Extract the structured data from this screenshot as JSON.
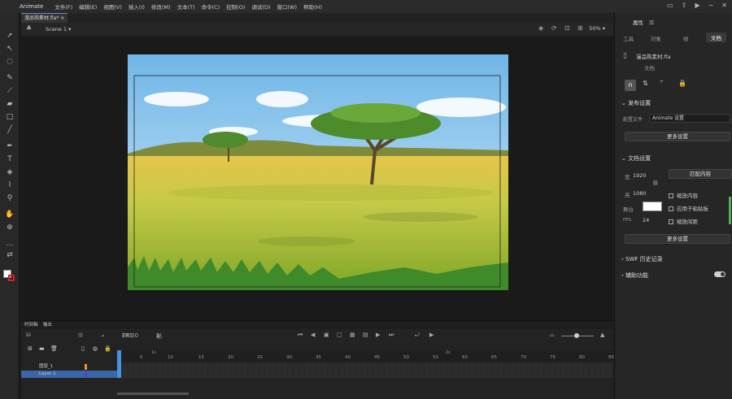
{
  "menubar": {
    "app": "Animate",
    "items": [
      "文件(F)",
      "编辑(E)",
      "视图(V)",
      "插入(I)",
      "修改(M)",
      "文本(T)",
      "命令(C)",
      "控制(O)",
      "调试(D)",
      "窗口(W)",
      "帮助(H)"
    ]
  },
  "document": {
    "tab": "漫品购素材.fla*"
  },
  "stagebar": {
    "scene": "Scene 1",
    "zoom": "50%"
  },
  "timeline": {
    "tabs": [
      "时间轴",
      "输出"
    ],
    "fps": "24.00",
    "fps_unit": "FPS",
    "frame": "1",
    "frame_unit": "帧",
    "ruler": [
      "1s",
      "5",
      "10",
      "15",
      "20",
      "25",
      "30",
      "35",
      "40",
      "45",
      "50",
      "55",
      "60",
      "65",
      "70",
      "75",
      "80",
      "85",
      "2s"
    ],
    "layers": [
      {
        "name": "图层_1",
        "selected": false
      },
      {
        "name": "Layer 1",
        "selected": true
      }
    ]
  },
  "props": {
    "tabs": [
      "工具",
      "对象",
      "帧",
      "文档"
    ],
    "active_tab": "文档",
    "header_tabs": [
      "属性",
      "库"
    ],
    "doc_name": "漫品购素材.fla",
    "doc_type": "文档",
    "publish": {
      "title": "发布设置",
      "profile_label": "配置文件",
      "profile_value": "Animate 设置",
      "more_button": "更多设置"
    },
    "docsettings": {
      "title": "文档设置",
      "width_label": "宽",
      "width": "1920",
      "height_label": "高",
      "height": "1080",
      "match_button": "匹配内容",
      "stage_label": "舞台",
      "fps_label": "FPS",
      "fps": "24",
      "checks": [
        "缩放内容",
        "应用于粘贴板",
        "缩放间距"
      ],
      "more_button": "更多设置"
    },
    "swf_history": "SWF 历史记录",
    "accessibility": "辅助功能"
  },
  "colors": {
    "accent": "#4a90e2",
    "toggle_on": "#cfcfcf"
  }
}
